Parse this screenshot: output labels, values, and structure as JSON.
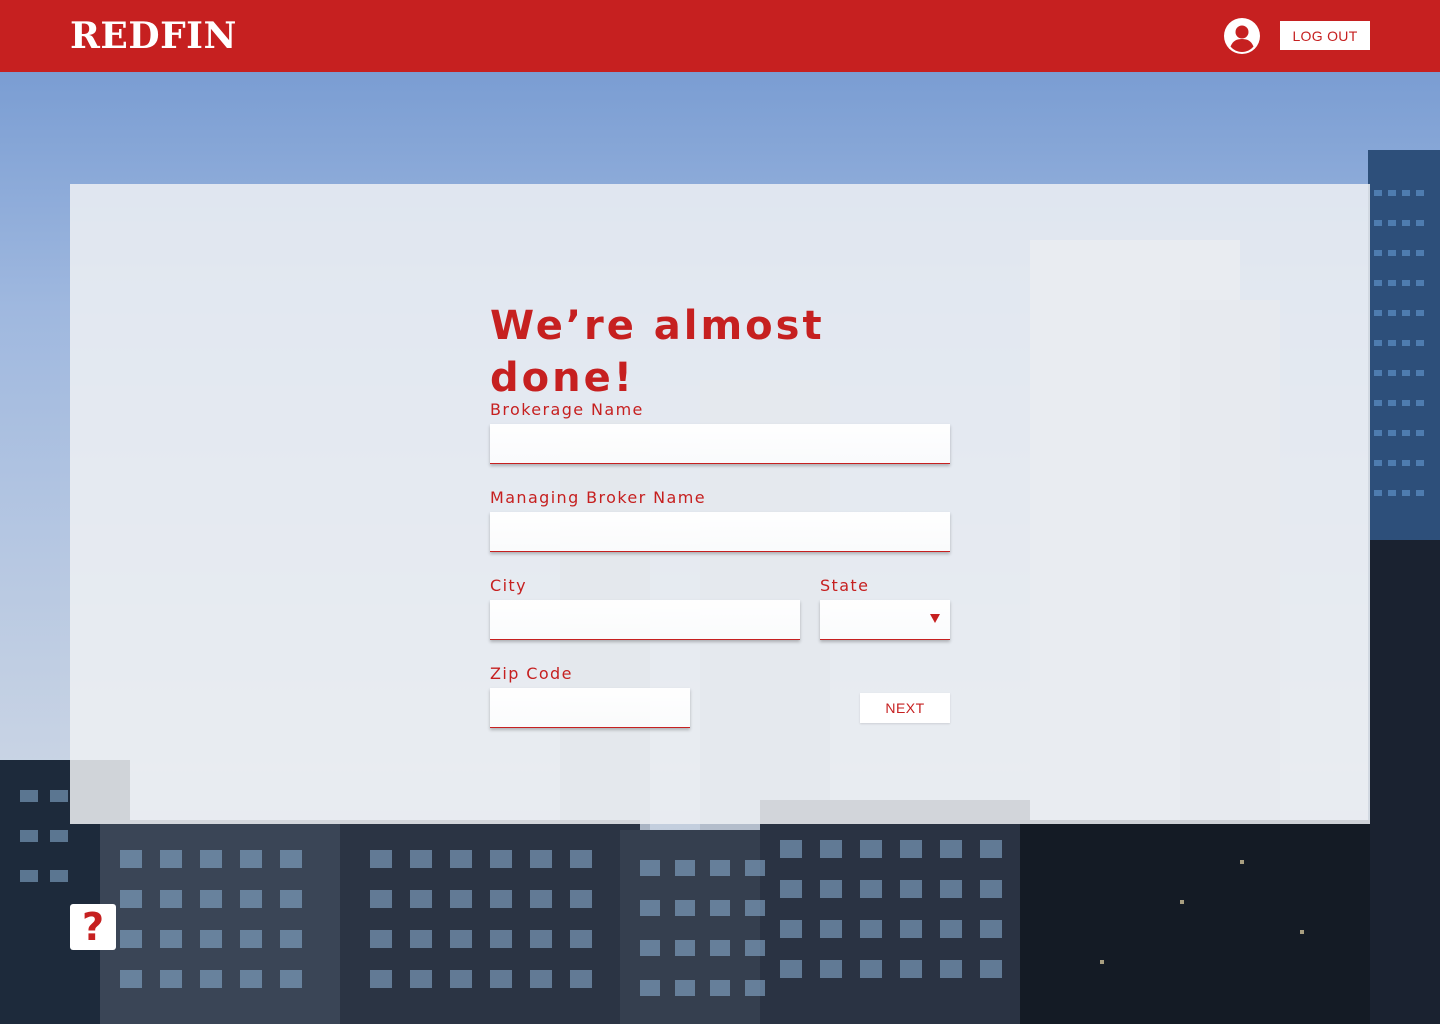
{
  "header": {
    "logo_text": "REDFIN",
    "account_icon": "user-circle-icon",
    "logout_label": "LOG OUT"
  },
  "form": {
    "title": "We’re almost done!",
    "brokerage_label": "Brokerage Name",
    "brokerage_value": "",
    "managing_broker_label": "Managing Broker Name",
    "managing_broker_value": "",
    "city_label": "City",
    "city_value": "",
    "state_label": "State",
    "state_value": "",
    "zip_label": "Zip Code",
    "zip_value": "",
    "next_label": "NEXT"
  },
  "help": {
    "label": "?",
    "icon": "help-question-icon"
  },
  "colors": {
    "brand": "#c62020",
    "card_bg": "#eef0f3",
    "white": "#ffffff"
  }
}
